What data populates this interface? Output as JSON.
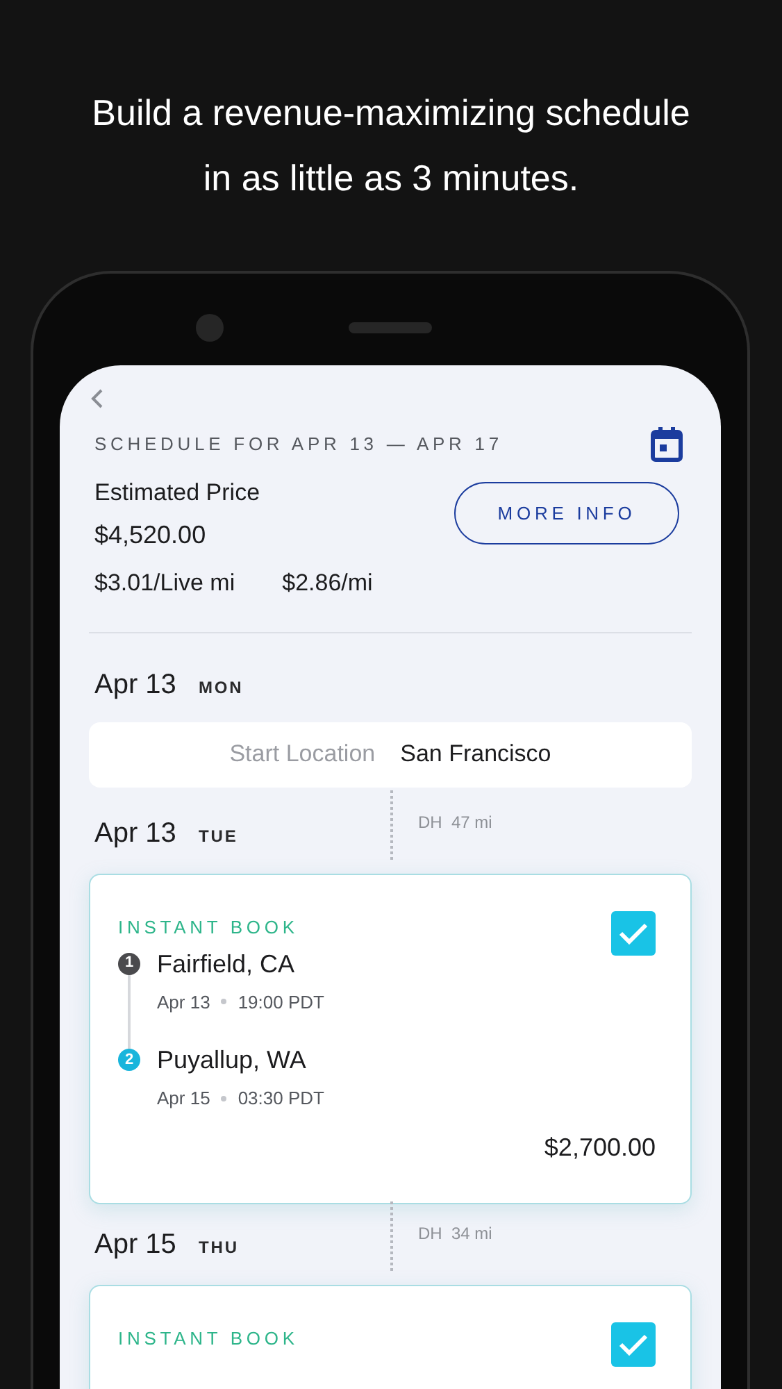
{
  "headline": "Build a revenue-maximizing schedule in as little as 3 minutes.",
  "schedule": {
    "title": "SCHEDULE FOR APR 13 — APR 17",
    "price_label": "Estimated Price",
    "price": "$4,520.00",
    "rates": [
      "$3.01/Live mi",
      "$2.86/mi"
    ],
    "button": "MORE INFO"
  },
  "days": [
    {
      "kind": "start",
      "date": "Apr 13",
      "weekday": "MON",
      "label": "Start Location",
      "value": "San Francisco"
    },
    {
      "kind": "load",
      "date": "Apr 13",
      "weekday": "TUE",
      "deadhead": "DH  47 mi",
      "tag": "INSTANT BOOK",
      "checked": true,
      "stops": [
        {
          "number": "1",
          "city": "Fairfield, CA",
          "date": "Apr 13",
          "time": "19:00 PDT"
        },
        {
          "number": "2",
          "city": "Puyallup, WA",
          "date": "Apr 15",
          "time": "03:30 PDT"
        }
      ],
      "price": "$2,700.00"
    },
    {
      "kind": "load",
      "date": "Apr 15",
      "weekday": "THU",
      "deadhead": "DH  34 mi",
      "tag": "INSTANT BOOK",
      "checked": true
    }
  ]
}
